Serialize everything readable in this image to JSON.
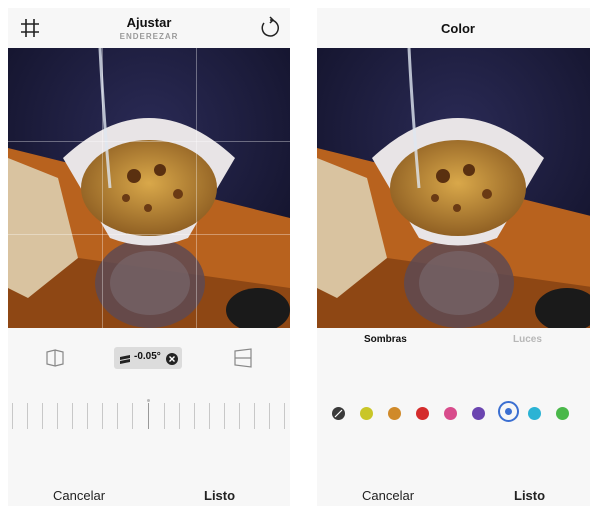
{
  "left_screen": {
    "title": "Ajustar",
    "subtitle": "ENDEREZAR",
    "straighten_value": "-0.05°",
    "cancel_label": "Cancelar",
    "done_label": "Listo",
    "icons": [
      "grid-icon",
      "rotate-icon",
      "vertical-perspective-icon",
      "straighten-icon",
      "clear-icon",
      "horizontal-perspective-icon"
    ]
  },
  "right_screen": {
    "title": "Color",
    "tabs": [
      {
        "label": "Sombras",
        "active": true
      },
      {
        "label": "Luces",
        "active": false
      }
    ],
    "swatches": [
      {
        "name": "none",
        "color": "#3a3a3a",
        "selected": false
      },
      {
        "name": "yellow",
        "color": "#c9c628",
        "selected": false
      },
      {
        "name": "orange",
        "color": "#d08a2a",
        "selected": false
      },
      {
        "name": "red",
        "color": "#d42c2c",
        "selected": false
      },
      {
        "name": "pink",
        "color": "#d84c8c",
        "selected": false
      },
      {
        "name": "purple",
        "color": "#6b45b0",
        "selected": false
      },
      {
        "name": "blue",
        "color": "#3b6fd1",
        "selected": true
      },
      {
        "name": "cyan",
        "color": "#2bb3d4",
        "selected": false
      },
      {
        "name": "green",
        "color": "#4ab84a",
        "selected": false
      }
    ],
    "cancel_label": "Cancelar",
    "done_label": "Listo"
  },
  "colors": {
    "panel_bg": "#f7f7f7",
    "accent_blue": "#3b6fd1"
  }
}
